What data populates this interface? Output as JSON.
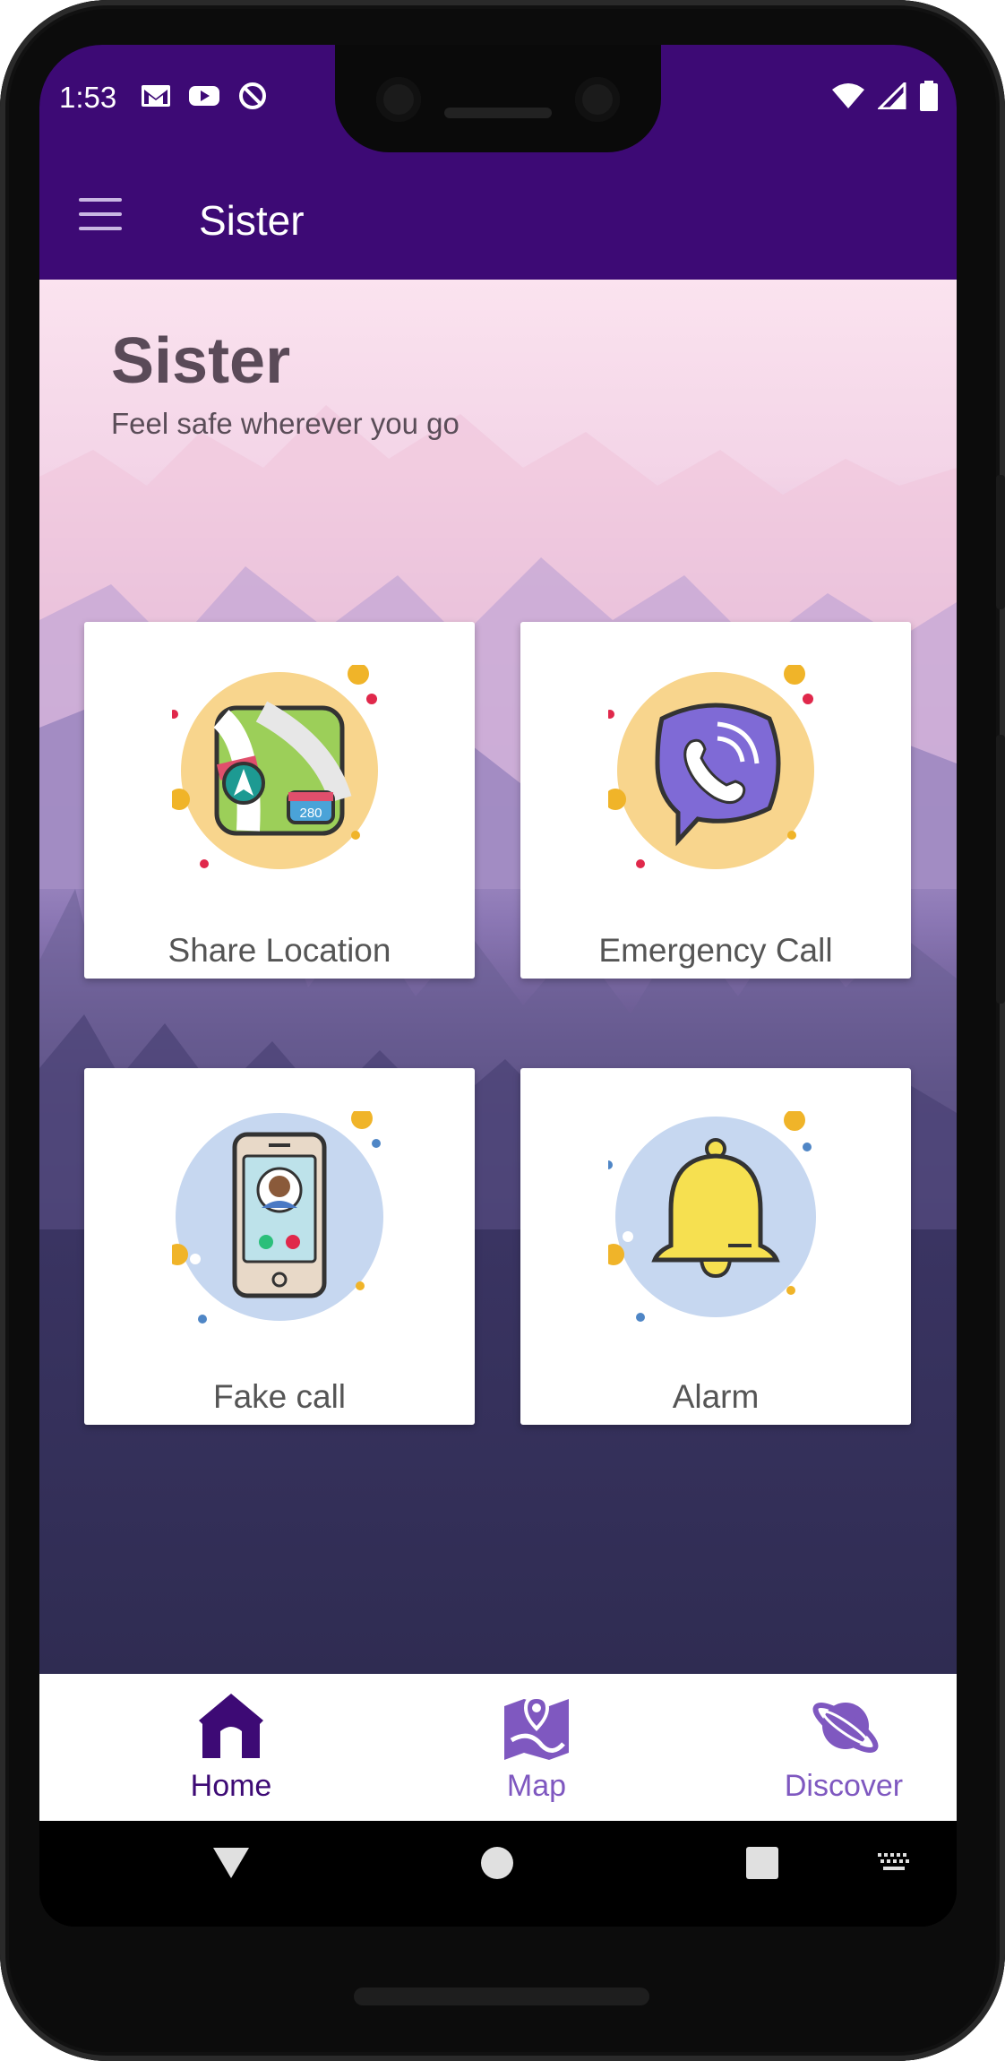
{
  "status_bar": {
    "time": "1:53",
    "icons": [
      "gmail-icon",
      "youtube-icon",
      "at-sign-icon",
      "wifi-icon",
      "signal-icon",
      "battery-icon"
    ]
  },
  "app_bar": {
    "title": "Sister",
    "menu_icon": "hamburger-menu-icon"
  },
  "hero": {
    "title": "Sister",
    "subtitle": "Feel safe wherever you go"
  },
  "cards": [
    {
      "label": "Share Location",
      "icon": "map-location-icon"
    },
    {
      "label": "Emergency Call",
      "icon": "phone-chat-icon"
    },
    {
      "label": "Fake call",
      "icon": "smartphone-caller-icon"
    },
    {
      "label": "Alarm",
      "icon": "bell-icon"
    }
  ],
  "bottom_nav": {
    "items": [
      {
        "label": "Home",
        "icon": "home-icon",
        "active": true
      },
      {
        "label": "Map",
        "icon": "map-pin-icon",
        "active": false
      },
      {
        "label": "Discover",
        "icon": "planet-icon",
        "active": false
      }
    ]
  },
  "colors": {
    "primary": "#3d0a75",
    "accent": "#7f58c0",
    "card_bg": "#ffffff"
  }
}
